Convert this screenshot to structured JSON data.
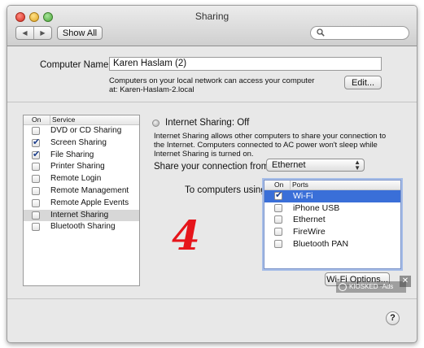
{
  "window": {
    "title": "Sharing"
  },
  "toolbar": {
    "back_glyph": "◀",
    "forward_glyph": "▶",
    "show_all_label": "Show All",
    "search_placeholder": ""
  },
  "computer_name": {
    "label": "Computer Name:",
    "value": "Karen Haslam (2)",
    "description": "Computers on your local network can access your computer at: Karen-Haslam-2.local",
    "edit_label": "Edit..."
  },
  "services": {
    "col_on": "On",
    "col_service": "Service",
    "items": [
      {
        "name": "DVD or CD Sharing",
        "checked": false
      },
      {
        "name": "Screen Sharing",
        "checked": true
      },
      {
        "name": "File Sharing",
        "checked": true
      },
      {
        "name": "Printer Sharing",
        "checked": false
      },
      {
        "name": "Remote Login",
        "checked": false
      },
      {
        "name": "Remote Management",
        "checked": false
      },
      {
        "name": "Remote Apple Events",
        "checked": false
      },
      {
        "name": "Internet Sharing",
        "checked": false,
        "selected": true
      },
      {
        "name": "Bluetooth Sharing",
        "checked": false
      }
    ]
  },
  "detail": {
    "status": "Internet Sharing: Off",
    "info": "Internet Sharing allows other computers to share your connection to the Internet. Computers connected to AC power won't sleep while Internet Sharing is turned on.",
    "share_from_label": "Share your connection from:",
    "share_from_value": "Ethernet",
    "to_computers_label": "To computers using:",
    "ports_col_on": "On",
    "ports_col_ports": "Ports",
    "ports": [
      {
        "name": "Wi-Fi",
        "checked": true,
        "selected": true
      },
      {
        "name": "iPhone USB",
        "checked": false
      },
      {
        "name": "Ethernet",
        "checked": false
      },
      {
        "name": "FireWire",
        "checked": false
      },
      {
        "name": "Bluetooth PAN",
        "checked": false
      }
    ],
    "wifi_options_label": "Wi-Fi Options..."
  },
  "annotation": {
    "step_number": "4"
  },
  "watermark": {
    "text": "KIOSKED ·Ads",
    "close": "✕"
  },
  "help": {
    "label": "?"
  },
  "colors": {
    "selection_blue": "#3a6fd8",
    "annotation_red": "#e6151b"
  }
}
